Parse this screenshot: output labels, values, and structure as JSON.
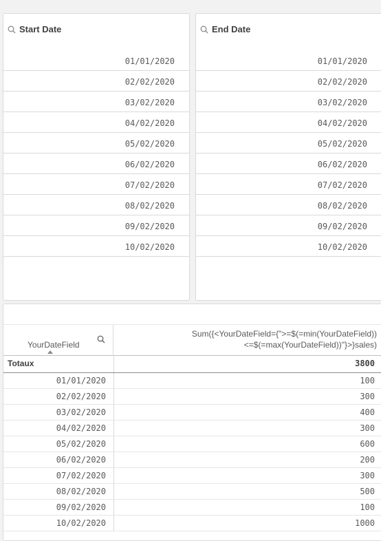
{
  "start_filter": {
    "title": "Start Date",
    "icon": "search-icon",
    "items": [
      "01/01/2020",
      "02/02/2020",
      "03/02/2020",
      "04/02/2020",
      "05/02/2020",
      "06/02/2020",
      "07/02/2020",
      "08/02/2020",
      "09/02/2020",
      "10/02/2020"
    ]
  },
  "end_filter": {
    "title": "End Date",
    "icon": "search-icon",
    "items": [
      "01/01/2020",
      "02/02/2020",
      "03/02/2020",
      "04/02/2020",
      "05/02/2020",
      "06/02/2020",
      "07/02/2020",
      "08/02/2020",
      "09/02/2020",
      "10/02/2020"
    ]
  },
  "table": {
    "dimension_header": "YourDateField",
    "measure_header_line1": "Sum({<YourDateField={\">=$(=min(YourDateField))",
    "measure_header_line2": "<=$(=max(YourDateField))\"}>}sales)",
    "totals_label": "Totaux",
    "totals_value": "3800",
    "rows": [
      {
        "date": "01/01/2020",
        "value": "100"
      },
      {
        "date": "02/02/2020",
        "value": "300"
      },
      {
        "date": "03/02/2020",
        "value": "400"
      },
      {
        "date": "04/02/2020",
        "value": "300"
      },
      {
        "date": "05/02/2020",
        "value": "600"
      },
      {
        "date": "06/02/2020",
        "value": "200"
      },
      {
        "date": "07/02/2020",
        "value": "300"
      },
      {
        "date": "08/02/2020",
        "value": "500"
      },
      {
        "date": "09/02/2020",
        "value": "100"
      },
      {
        "date": "10/02/2020",
        "value": "1000"
      }
    ]
  },
  "colors": {
    "background": "#f2f2f2",
    "panel": "#ffffff",
    "border": "#d9d9d9",
    "text": "#595959"
  }
}
